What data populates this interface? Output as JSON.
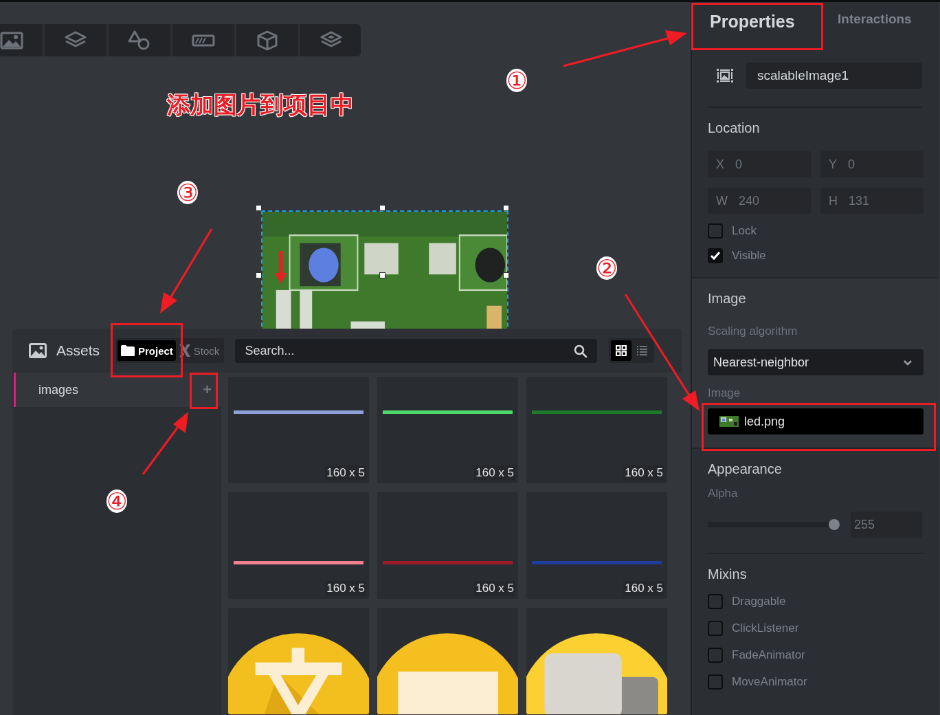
{
  "annotation": {
    "title": "添加图片到项目中",
    "markers": [
      "①",
      "②",
      "③",
      "④"
    ]
  },
  "canvas": {
    "image": {
      "kind": "picture",
      "selected": true
    }
  },
  "assets": {
    "title": "Assets",
    "tabs": [
      {
        "label": "Project",
        "selected": true
      },
      {
        "label": "Stock",
        "selected": false
      }
    ],
    "search": {
      "placeholder": "Search..."
    },
    "views": [
      {
        "kind": "grid",
        "selected": true
      },
      {
        "kind": "list",
        "selected": false
      }
    ],
    "folders": [
      {
        "label": "images",
        "selected": true,
        "add": "+"
      }
    ],
    "items": [
      {
        "kind": "line",
        "color": "#8ea0d8",
        "size": "160 x 5"
      },
      {
        "kind": "line",
        "color": "#4fd96b",
        "size": "160 x 5"
      },
      {
        "kind": "line",
        "color": "#1c7a2a",
        "size": "160 x 5"
      },
      {
        "kind": "line",
        "color": "#f2808f",
        "size": "160 x 5"
      },
      {
        "kind": "line",
        "color": "#9c1a2a",
        "size": "160 x 5"
      },
      {
        "kind": "line",
        "color": "#1f3d9c",
        "size": "160 x 5"
      },
      {
        "kind": "picture"
      },
      {
        "kind": "picture"
      },
      {
        "kind": "picture"
      }
    ]
  },
  "properties": {
    "tabs": [
      {
        "label": "Properties",
        "selected": true
      },
      {
        "label": "Interactions",
        "selected": false
      }
    ],
    "name": "scalableImage1",
    "location": {
      "title": "Location",
      "fields": [
        {
          "label": "X",
          "value": "0"
        },
        {
          "label": "Y",
          "value": "0"
        },
        {
          "label": "W",
          "value": "240"
        },
        {
          "label": "H",
          "value": "131"
        }
      ],
      "options": [
        {
          "label": "Lock",
          "checked": false
        },
        {
          "label": "Visible",
          "checked": true
        }
      ]
    },
    "image": {
      "title": "Image",
      "scaling_label": "Scaling algorithm",
      "scaling_value": "Nearest-neighbor",
      "image_label": "Image",
      "image_value": "led.png"
    },
    "appearance": {
      "title": "Appearance",
      "alpha_label": "Alpha",
      "alpha": {
        "level": 1,
        "value": "255"
      }
    },
    "mixins": {
      "title": "Mixins",
      "options": [
        {
          "label": "Draggable",
          "checked": false
        },
        {
          "label": "ClickListener",
          "checked": false
        },
        {
          "label": "FadeAnimator",
          "checked": false
        },
        {
          "label": "MoveAnimator",
          "checked": false
        }
      ]
    }
  }
}
